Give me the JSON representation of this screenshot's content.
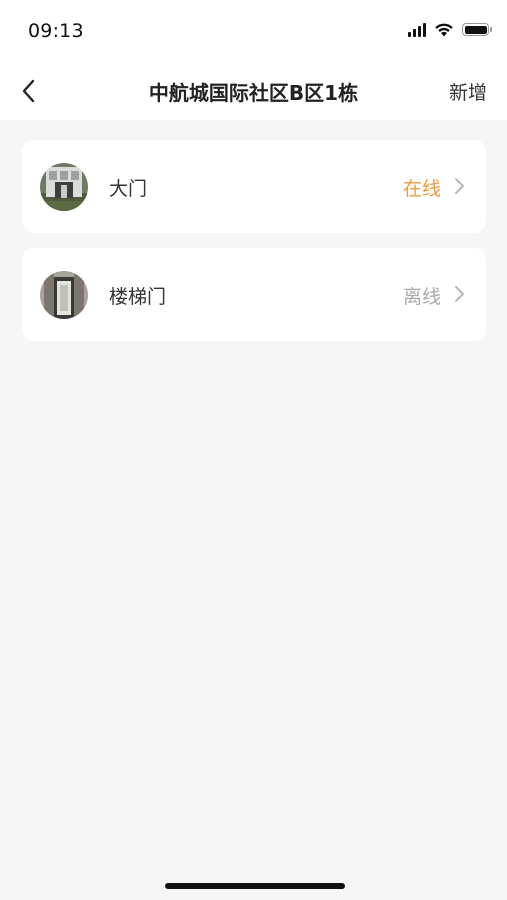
{
  "status_bar": {
    "time": "09:13",
    "icons": [
      "signal-icon",
      "wifi-icon",
      "battery-icon"
    ]
  },
  "nav": {
    "back_icon": "chevron-left-icon",
    "title": "中航城国际社区B区1栋",
    "add_label": "新增"
  },
  "doors": [
    {
      "name": "大门",
      "status": "在线",
      "state": "online",
      "avatar_icon": "door-photo-icon"
    },
    {
      "name": "楼梯门",
      "status": "离线",
      "state": "offline",
      "avatar_icon": "door-photo-icon"
    }
  ],
  "colors": {
    "background": "#f6f6f6",
    "card": "#ffffff",
    "online": "#f09a3c",
    "offline": "#aaaaaa",
    "text": "#333333"
  }
}
